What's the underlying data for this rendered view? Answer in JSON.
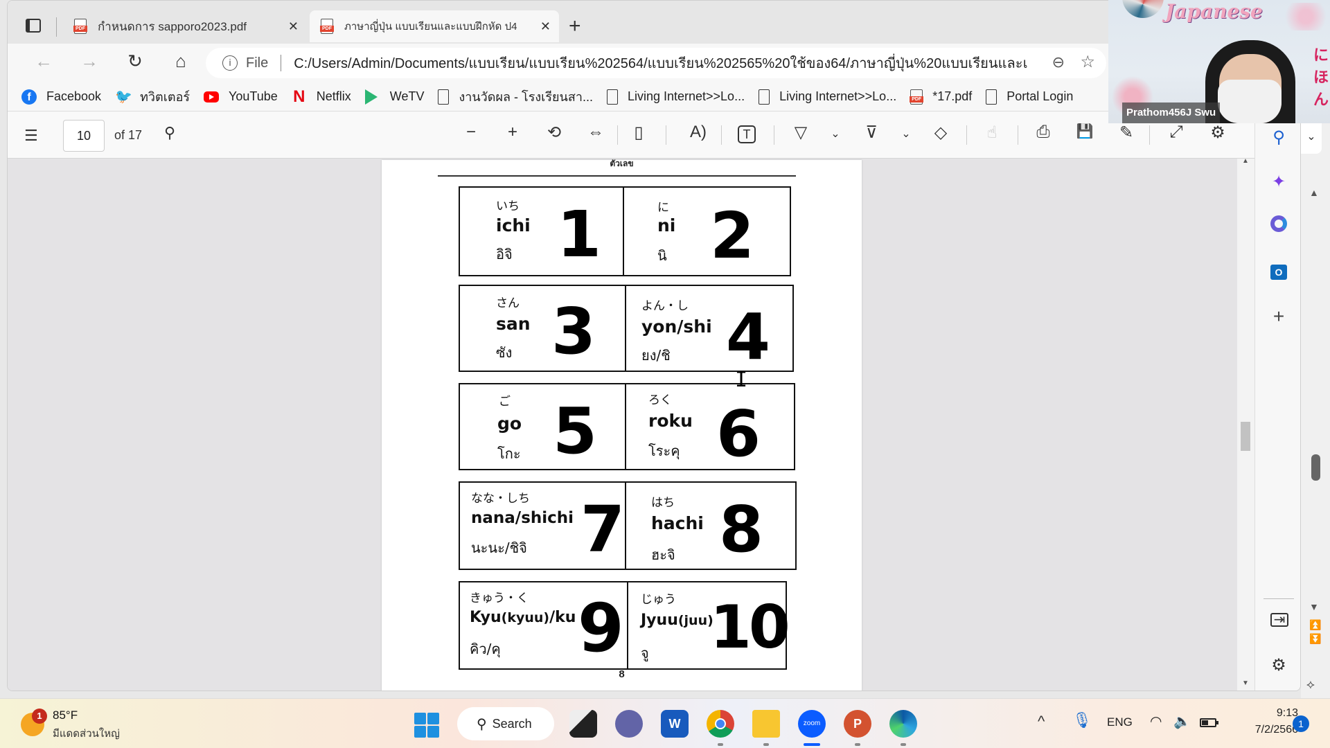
{
  "browser": {
    "tabs": [
      {
        "title": "กำหนดการ sapporo2023.pdf",
        "icon": "pdf-icon",
        "active": false
      },
      {
        "title": "ภาษาญี่ปุ่น แบบเรียนและแบบฝึกหัด ป4",
        "icon": "pdf-icon",
        "active": true
      }
    ],
    "close_glyph": "✕",
    "new_tab_glyph": "+",
    "address": {
      "info_glyph": "i",
      "scheme_label": "File",
      "url": "C:/Users/Admin/Documents/แบบเรียน/แบบเรียน%202564/แบบเรียน%202565%20ใช้ของ64/ภาษาญี่ปุ่น%20แบบเรียนและแ..."
    },
    "nav": {
      "back": "←",
      "forward": "→",
      "refresh": "↻",
      "home": "⌂",
      "zoom": "⊖",
      "favorite": "☆"
    },
    "bookmarks": [
      {
        "label": "Facebook",
        "icon": "facebook-icon"
      },
      {
        "label": "ทวิตเตอร์",
        "icon": "twitter-icon"
      },
      {
        "label": "YouTube",
        "icon": "youtube-icon"
      },
      {
        "label": "Netflix",
        "icon": "netflix-icon"
      },
      {
        "label": "WeTV",
        "icon": "wetv-icon"
      },
      {
        "label": "งานวัดผล - โรงเรียนสา...",
        "icon": "page-icon"
      },
      {
        "label": "Living Internet>>Lo...",
        "icon": "page-icon"
      },
      {
        "label": "Living Internet>>Lo...",
        "icon": "page-icon"
      },
      {
        "label": "*17.pdf",
        "icon": "pdf-icon"
      },
      {
        "label": "Portal Login",
        "icon": "page-icon"
      }
    ]
  },
  "pdf_toolbar": {
    "current_page": "10",
    "page_total_label": "of 17",
    "glyphs": {
      "toc": "☰",
      "search": "⚲",
      "zoom_out": "−",
      "zoom_in": "+",
      "rotate": "⟲",
      "fit": "⇔",
      "page_view": "▯",
      "read_aloud": "A)",
      "text": "T",
      "draw": "▽",
      "chevron": "⌄",
      "highlight": "⊽",
      "erase": "◇",
      "touch": "☝",
      "print": "⎙",
      "save": "💾",
      "save_as": "✎",
      "fullscreen": "⤢",
      "settings": "⚙"
    }
  },
  "pdf_page": {
    "header_partial": "ตัวเลข",
    "page_number": "8",
    "cards": [
      {
        "kana": "いち",
        "romaji": "ichi",
        "romaji_note": "",
        "thai": "อิจิ",
        "number": "1"
      },
      {
        "kana": "に",
        "romaji": "ni",
        "romaji_note": "",
        "thai": "นิ",
        "number": "2"
      },
      {
        "kana": "さん",
        "romaji": "san",
        "romaji_note": "",
        "thai": "ซัง",
        "number": "3"
      },
      {
        "kana": "よん・し",
        "romaji": "yon/shi",
        "romaji_note": "",
        "thai": "ยง/ชิ",
        "number": "4"
      },
      {
        "kana": "ご",
        "romaji": "go",
        "romaji_note": "",
        "thai": "โกะ",
        "number": "5"
      },
      {
        "kana": "ろく",
        "romaji": "roku",
        "romaji_note": "",
        "thai": "โระคุ",
        "number": "6"
      },
      {
        "kana": "なな・しち",
        "romaji": "nana/shichi",
        "romaji_note": "",
        "thai": "นะนะ/ชิจิ",
        "number": "7"
      },
      {
        "kana": "はち",
        "romaji": "hachi",
        "romaji_note": "",
        "thai": "ฮะจิ",
        "number": "8"
      },
      {
        "kana": "きゅう・く",
        "romaji": "Kyu",
        "romaji_note": "(kyuu)",
        "romaji_suffix": "/ku",
        "thai": "คิว/คุ",
        "number": "9"
      },
      {
        "kana": "じゅう",
        "romaji": "Jyuu",
        "romaji_note": "(juu)",
        "romaji_suffix": "",
        "thai": "จู",
        "number": "10"
      }
    ]
  },
  "video_overlay": {
    "title": "Japanese",
    "side_kana": [
      "に",
      "ほ",
      "ん"
    ],
    "participant_name": "Prathom456J Swu"
  },
  "edge_sidebar": {
    "items": [
      "search-icon",
      "copilot-icon",
      "microsoft365-icon",
      "outlook-icon",
      "add-icon",
      "split-screen-icon",
      "settings-icon"
    ],
    "glyphs": {
      "add": "+",
      "settings": "⚙",
      "split": "⇥"
    }
  },
  "taskbar": {
    "weather": {
      "temp": "85°F",
      "desc": "มีแดดส่วนใหญ่",
      "badge": "1"
    },
    "search_label": "Search",
    "search_glyph": "⚲",
    "apps": [
      "task-view",
      "teams",
      "word",
      "chrome",
      "file-explorer",
      "zoom",
      "powerpoint",
      "edge"
    ],
    "active_app": "zoom",
    "tray": {
      "chevron": "^",
      "mic": "🎙",
      "language": "ENG",
      "wifi": "◠",
      "volume": "🔈"
    },
    "clock": {
      "time": "9:13",
      "date": "7/2/2566"
    },
    "notification_count": "1"
  },
  "colors": {
    "accent": "#0b63ce",
    "pdf_red": "#e2442f",
    "taskbar_zoom": "#0b5cff"
  }
}
